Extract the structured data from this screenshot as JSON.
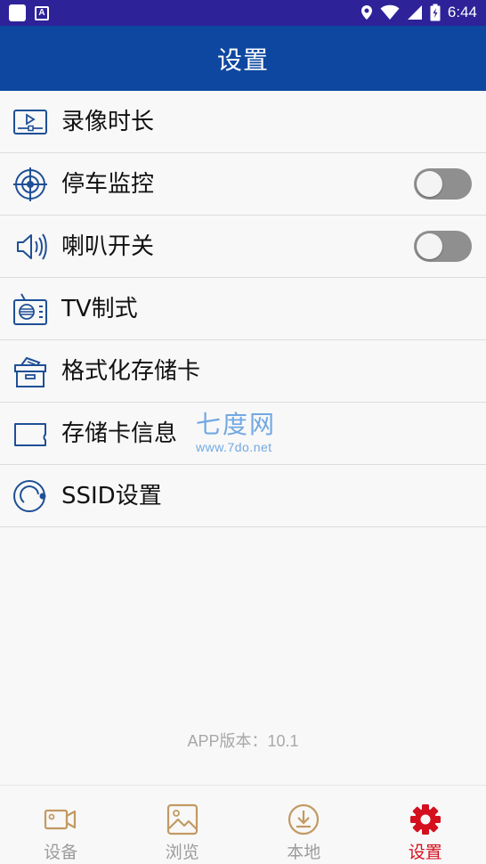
{
  "status_bar": {
    "time": "6:44"
  },
  "app_bar": {
    "title": "设置"
  },
  "settings": [
    {
      "label": "录像时长",
      "icon": "video-duration-icon"
    },
    {
      "label": "停车监控",
      "icon": "crosshair-target-icon",
      "toggle": false
    },
    {
      "label": "喇叭开关",
      "icon": "speaker-icon",
      "toggle": false
    },
    {
      "label": "TV制式",
      "icon": "tv-radio-icon"
    },
    {
      "label": "格式化存储卡",
      "icon": "storage-box-icon"
    },
    {
      "label": "存储卡信息",
      "icon": "sd-card-icon"
    },
    {
      "label": "SSID设置",
      "icon": "ssid-icon"
    }
  ],
  "watermark": {
    "title": "七度网",
    "url": "www.7do.net"
  },
  "version": "APP版本：10.1",
  "bottom_nav": [
    {
      "label": "设备",
      "icon": "camera-icon",
      "active": false
    },
    {
      "label": "浏览",
      "icon": "image-icon",
      "active": false
    },
    {
      "label": "本地",
      "icon": "download-icon",
      "active": false
    },
    {
      "label": "设置",
      "icon": "gear-icon",
      "active": true
    }
  ],
  "colors": {
    "status_bar": "#2d2298",
    "app_bar": "#0e47a0",
    "icon_blue": "#1f4f96",
    "nav_inactive": "#c29a62",
    "nav_active": "#d4101e",
    "switch_off": "#8f8f8f"
  }
}
